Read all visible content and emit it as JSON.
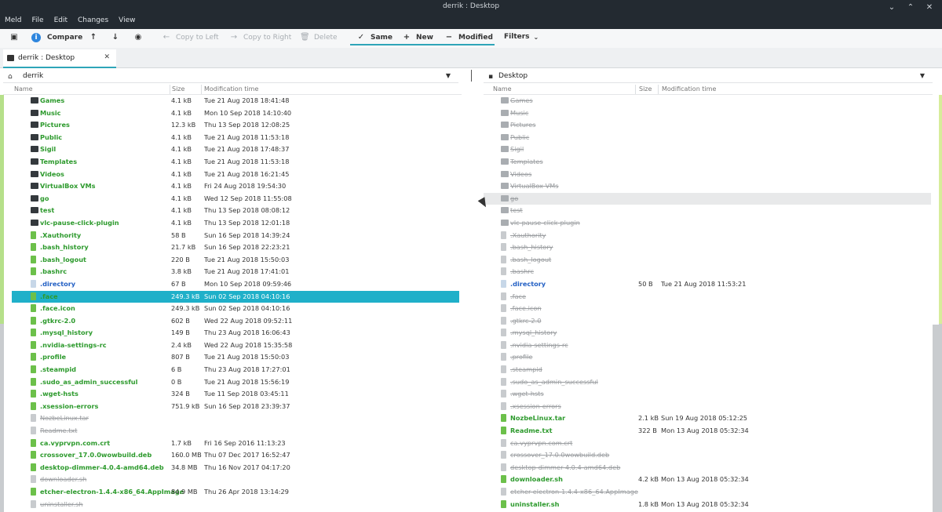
{
  "window": {
    "title": "derrik : Desktop",
    "menus": [
      "Meld",
      "File",
      "Edit",
      "Changes",
      "View"
    ],
    "controls": [
      "minimize-icon",
      "maximize-icon",
      "close-icon"
    ]
  },
  "toolbar": {
    "compare": "Compare",
    "copy_left": "Copy to Left",
    "copy_right": "Copy to Right",
    "delete": "Delete",
    "same": "Same",
    "new": "New",
    "modified": "Modified",
    "filters": "Filters"
  },
  "tab": {
    "label": "derrik : Desktop"
  },
  "left": {
    "path": "derrik",
    "icon": "home-icon"
  },
  "right": {
    "path": "Desktop",
    "icon": "desktop-icon"
  },
  "columns": {
    "name": "Name",
    "size": "Size",
    "modified": "Modification time"
  },
  "colors": {
    "accent": "#2ea5b8",
    "new": "#2d9a2d",
    "modified": "#2360c4",
    "same": "#9a9da0"
  },
  "rows": [
    {
      "type": "folder",
      "name": "Games",
      "state": "new",
      "lsize": "4.1 kB",
      "ltime": "Tue 21 Aug 2018 18:41:48",
      "rsize": "",
      "rtime": "",
      "rstate": "same"
    },
    {
      "type": "folder",
      "name": "Music",
      "state": "new",
      "lsize": "4.1 kB",
      "ltime": "Mon 10 Sep 2018 14:10:40",
      "rsize": "",
      "rtime": "",
      "rstate": "same"
    },
    {
      "type": "folder",
      "name": "Pictures",
      "state": "new",
      "lsize": "12.3 kB",
      "ltime": "Thu 13 Sep 2018 12:08:25",
      "rsize": "",
      "rtime": "",
      "rstate": "same"
    },
    {
      "type": "folder",
      "name": "Public",
      "state": "new",
      "lsize": "4.1 kB",
      "ltime": "Tue 21 Aug 2018 11:53:18",
      "rsize": "",
      "rtime": "",
      "rstate": "same"
    },
    {
      "type": "folder",
      "name": "Sigil",
      "state": "new",
      "lsize": "4.1 kB",
      "ltime": "Tue 21 Aug 2018 17:48:37",
      "rsize": "",
      "rtime": "",
      "rstate": "same"
    },
    {
      "type": "folder",
      "name": "Templates",
      "state": "new",
      "lsize": "4.1 kB",
      "ltime": "Tue 21 Aug 2018 11:53:18",
      "rsize": "",
      "rtime": "",
      "rstate": "same"
    },
    {
      "type": "folder",
      "name": "Videos",
      "state": "new",
      "lsize": "4.1 kB",
      "ltime": "Tue 21 Aug 2018 16:21:45",
      "rsize": "",
      "rtime": "",
      "rstate": "same"
    },
    {
      "type": "folder",
      "name": "VirtualBox VMs",
      "state": "new",
      "lsize": "4.1 kB",
      "ltime": "Fri 24 Aug 2018 19:54:30",
      "rsize": "",
      "rtime": "",
      "rstate": "same"
    },
    {
      "type": "folder",
      "name": "go",
      "state": "new",
      "lsize": "4.1 kB",
      "ltime": "Wed 12 Sep 2018 11:55:08",
      "rsize": "",
      "rtime": "",
      "rstate": "same",
      "rhl": true
    },
    {
      "type": "folder",
      "name": "test",
      "state": "new",
      "lsize": "4.1 kB",
      "ltime": "Thu 13 Sep 2018 08:08:12",
      "rsize": "",
      "rtime": "",
      "rstate": "same"
    },
    {
      "type": "folder",
      "name": "vlc-pause-click-plugin",
      "state": "new",
      "lsize": "4.1 kB",
      "ltime": "Thu 13 Sep 2018 12:01:18",
      "rsize": "",
      "rtime": "",
      "rstate": "same"
    },
    {
      "type": "file",
      "name": ".Xauthority",
      "state": "new",
      "lsize": "58 B",
      "ltime": "Sun 16 Sep 2018 14:39:24",
      "rsize": "",
      "rtime": "",
      "rstate": "same"
    },
    {
      "type": "file",
      "name": ".bash_history",
      "state": "new",
      "lsize": "21.7 kB",
      "ltime": "Sun 16 Sep 2018 22:23:21",
      "rsize": "",
      "rtime": "",
      "rstate": "same"
    },
    {
      "type": "file",
      "name": ".bash_logout",
      "state": "new",
      "lsize": "220 B",
      "ltime": "Tue 21 Aug 2018 15:50:03",
      "rsize": "",
      "rtime": "",
      "rstate": "same"
    },
    {
      "type": "file",
      "name": ".bashrc",
      "state": "new",
      "lsize": "3.8 kB",
      "ltime": "Tue 21 Aug 2018 17:41:01",
      "rsize": "",
      "rtime": "",
      "rstate": "same"
    },
    {
      "type": "file",
      "name": ".directory",
      "state": "mod",
      "lsize": "67 B",
      "ltime": "Mon 10 Sep 2018 09:59:46",
      "rsize": "50 B",
      "rtime": "Tue 21 Aug 2018 11:53:21",
      "rstate": "mod"
    },
    {
      "type": "file",
      "name": ".face",
      "state": "new",
      "lsize": "249.3 kB",
      "ltime": "Sun 02 Sep 2018 04:10:16",
      "rsize": "",
      "rtime": "",
      "rstate": "same",
      "sel": true
    },
    {
      "type": "file",
      "name": ".face.icon",
      "state": "new",
      "lsize": "249.3 kB",
      "ltime": "Sun 02 Sep 2018 04:10:16",
      "rsize": "",
      "rtime": "",
      "rstate": "same"
    },
    {
      "type": "file",
      "name": ".gtkrc-2.0",
      "state": "new",
      "lsize": "602 B",
      "ltime": "Wed 22 Aug 2018 09:52:11",
      "rsize": "",
      "rtime": "",
      "rstate": "same"
    },
    {
      "type": "file",
      "name": ".mysql_history",
      "state": "new",
      "lsize": "149 B",
      "ltime": "Thu 23 Aug 2018 16:06:43",
      "rsize": "",
      "rtime": "",
      "rstate": "same"
    },
    {
      "type": "file",
      "name": ".nvidia-settings-rc",
      "state": "new",
      "lsize": "2.4 kB",
      "ltime": "Wed 22 Aug 2018 15:35:58",
      "rsize": "",
      "rtime": "",
      "rstate": "same"
    },
    {
      "type": "file",
      "name": ".profile",
      "state": "new",
      "lsize": "807 B",
      "ltime": "Tue 21 Aug 2018 15:50:03",
      "rsize": "",
      "rtime": "",
      "rstate": "same"
    },
    {
      "type": "file",
      "name": ".steampid",
      "state": "new",
      "lsize": "6 B",
      "ltime": "Thu 23 Aug 2018 17:27:01",
      "rsize": "",
      "rtime": "",
      "rstate": "same"
    },
    {
      "type": "file",
      "name": ".sudo_as_admin_successful",
      "state": "new",
      "lsize": "0 B",
      "ltime": "Tue 21 Aug 2018 15:56:19",
      "rsize": "",
      "rtime": "",
      "rstate": "same"
    },
    {
      "type": "file",
      "name": ".wget-hsts",
      "state": "new",
      "lsize": "324 B",
      "ltime": "Tue 11 Sep 2018 03:45:11",
      "rsize": "",
      "rtime": "",
      "rstate": "same"
    },
    {
      "type": "file",
      "name": ".xsession-errors",
      "state": "new",
      "lsize": "751.9 kB",
      "ltime": "Sun 16 Sep 2018 23:39:37",
      "rsize": "",
      "rtime": "",
      "rstate": "same"
    },
    {
      "type": "file",
      "name": "NozbeLinux.tar",
      "state": "same",
      "lsize": "",
      "ltime": "",
      "rsize": "2.1 kB",
      "rtime": "Sun 19 Aug 2018 05:12:25",
      "rstate": "new"
    },
    {
      "type": "file",
      "name": "Readme.txt",
      "state": "same",
      "lsize": "",
      "ltime": "",
      "rsize": "322 B",
      "rtime": "Mon 13 Aug 2018 05:32:34",
      "rstate": "new"
    },
    {
      "type": "file",
      "name": "ca.vyprvpn.com.crt",
      "state": "new",
      "lsize": "1.7 kB",
      "ltime": "Fri 16 Sep 2016 11:13:23",
      "rsize": "",
      "rtime": "",
      "rstate": "same"
    },
    {
      "type": "file",
      "name": "crossover_17.0.0wowbuild.deb",
      "state": "new",
      "lsize": "160.0 MB",
      "ltime": "Thu 07 Dec 2017 16:52:47",
      "rsize": "",
      "rtime": "",
      "rstate": "same"
    },
    {
      "type": "file",
      "name": "desktop-dimmer-4.0.4-amd64.deb",
      "state": "new",
      "lsize": "34.8 MB",
      "ltime": "Thu 16 Nov 2017 04:17:20",
      "rsize": "",
      "rtime": "",
      "rstate": "same"
    },
    {
      "type": "file",
      "name": "downloader.sh",
      "state": "same",
      "lsize": "",
      "ltime": "",
      "rsize": "4.2 kB",
      "rtime": "Mon 13 Aug 2018 05:32:34",
      "rstate": "new"
    },
    {
      "type": "file",
      "name": "etcher-electron-1.4.4-x86_64.AppImage",
      "state": "new",
      "lsize": "84.9 MB",
      "ltime": "Thu 26 Apr 2018 13:14:29",
      "rsize": "",
      "rtime": "",
      "rstate": "same"
    },
    {
      "type": "file",
      "name": "uninstaller.sh",
      "state": "same",
      "lsize": "",
      "ltime": "",
      "rsize": "1.8 kB",
      "rtime": "Mon 13 Aug 2018 05:32:34",
      "rstate": "new"
    }
  ]
}
